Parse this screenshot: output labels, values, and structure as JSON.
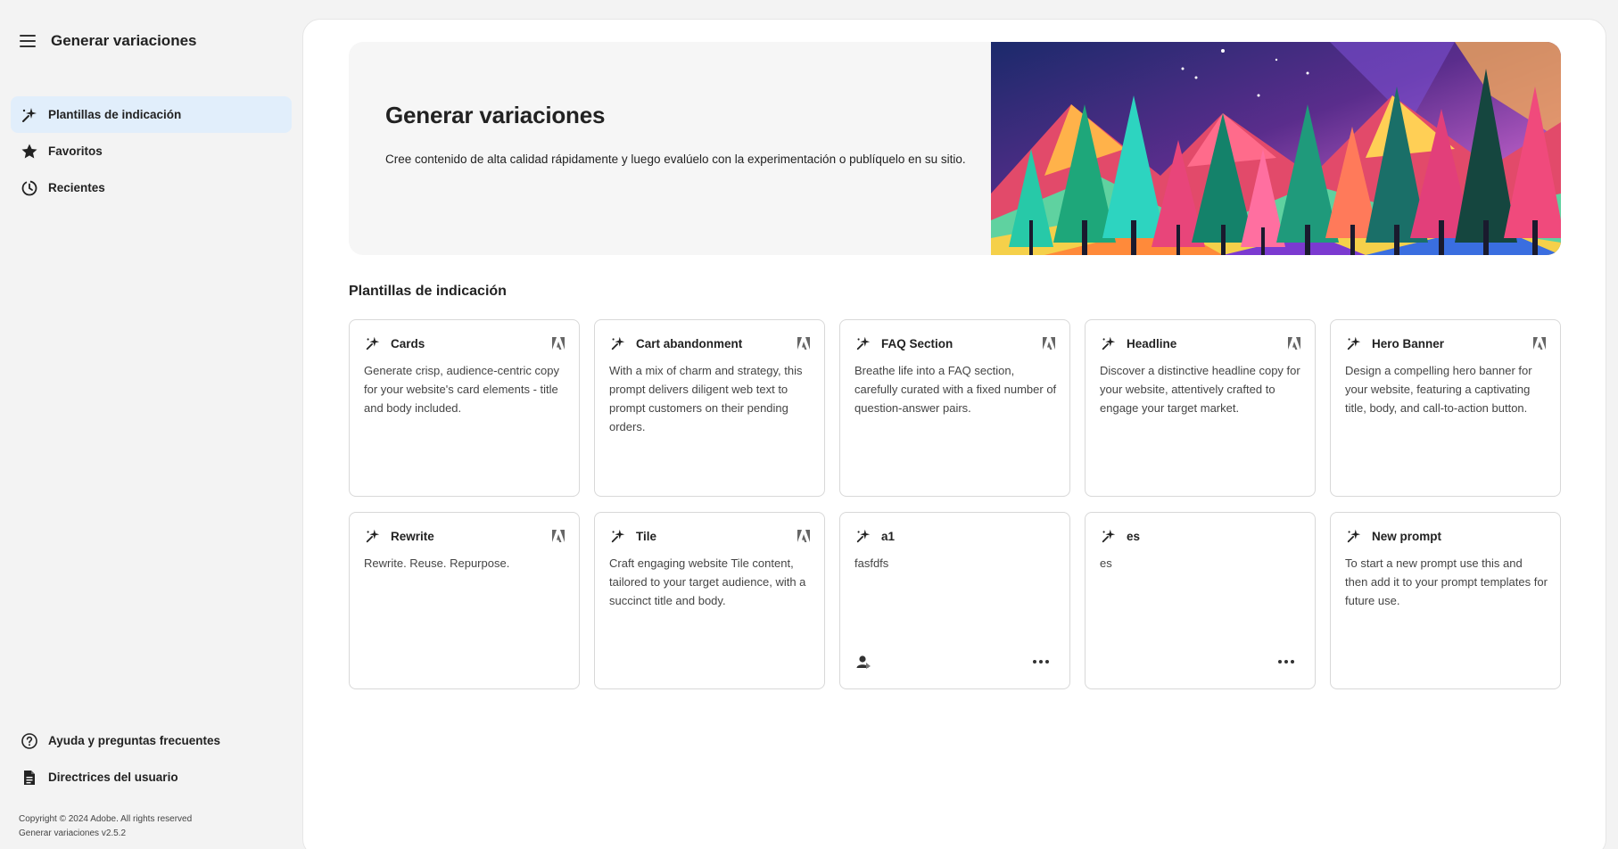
{
  "sidebar": {
    "title": "Generar variaciones",
    "items": [
      {
        "label": "Plantillas de indicación",
        "icon": "sparkle-icon",
        "active": true
      },
      {
        "label": "Favoritos",
        "icon": "star-icon",
        "active": false
      },
      {
        "label": "Recientes",
        "icon": "recent-icon",
        "active": false
      }
    ],
    "bottom_items": [
      {
        "label": "Ayuda y preguntas frecuentes",
        "icon": "help-icon"
      },
      {
        "label": "Directrices del usuario",
        "icon": "document-icon"
      }
    ],
    "copyright": "Copyright © 2024 Adobe. All rights reserved",
    "version": "Generar variaciones v2.5.2"
  },
  "hero": {
    "title": "Generar variaciones",
    "description": "Cree contenido de alta calidad rápidamente y luego evalúelo con la experimentación o publíquelo en su sitio."
  },
  "section_title": "Plantillas de indicación",
  "cards": [
    {
      "title": "Cards",
      "description": "Generate crisp, audience-centric copy for your website's card elements - title and body included.",
      "badge": "adobe-icon"
    },
    {
      "title": "Cart abandonment",
      "description": "With a mix of charm and strategy, this prompt delivers diligent web text to prompt customers on their pending orders.",
      "badge": "adobe-icon"
    },
    {
      "title": "FAQ Section",
      "description": "Breathe life into a FAQ section, carefully curated with a fixed number of question-answer pairs.",
      "badge": "adobe-icon"
    },
    {
      "title": "Headline",
      "description": "Discover a distinctive headline copy for your website, attentively crafted to engage your target market.",
      "badge": "adobe-icon"
    },
    {
      "title": "Hero Banner",
      "description": "Design a compelling hero banner for your website, featuring a captivating title, body, and call-to-action button.",
      "badge": "adobe-icon"
    },
    {
      "title": "Rewrite",
      "description": "Rewrite. Reuse. Repurpose.",
      "badge": "adobe-icon"
    },
    {
      "title": "Tile",
      "description": "Craft engaging website Tile content, tailored to your target audience, with a succinct title and body.",
      "badge": "adobe-icon"
    },
    {
      "title": "a1",
      "description": "fasfdfs",
      "badge": "",
      "shared": true,
      "menu": true
    },
    {
      "title": "es",
      "description": "es",
      "badge": "",
      "shared": false,
      "menu": true
    },
    {
      "title": "New prompt",
      "description": "To start a new prompt use this and then add it to your prompt templates for future use.",
      "badge": ""
    }
  ]
}
